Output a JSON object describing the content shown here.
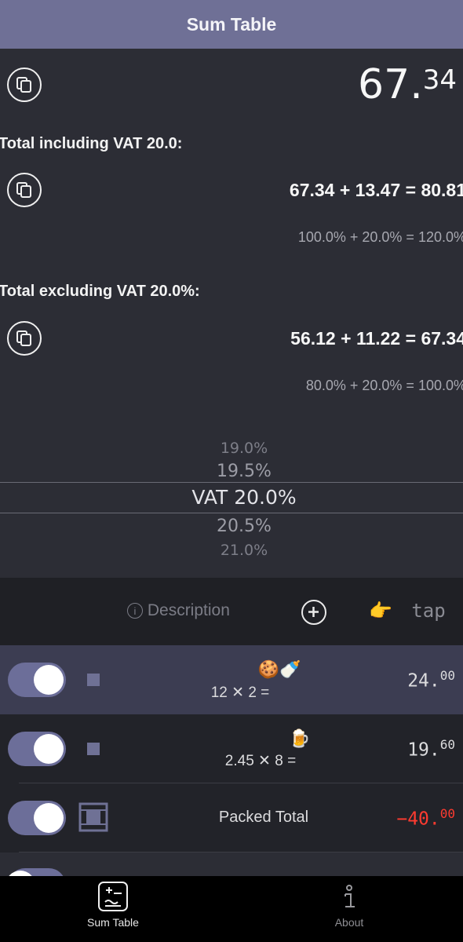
{
  "nav": {
    "title": "Sum Table"
  },
  "total": {
    "integer": "67.",
    "cents": "34"
  },
  "including": {
    "label": "Total including VAT 20.0:",
    "equation": "67.34 + 13.47 = 80.81",
    "percent": "100.0% + 20.0% = 120.0%"
  },
  "excluding": {
    "label": "Total excluding VAT 20.0%:",
    "equation": "56.12 + 11.22 = 67.34",
    "percent": "80.0% + 20.0% = 100.0%"
  },
  "vat_picker": {
    "above": [
      "19.0%",
      "19.5%"
    ],
    "selected": "VAT 20.0%",
    "below": [
      "20.5%",
      "21.0%"
    ]
  },
  "toolbar": {
    "description_label": "Description",
    "tap_label": "tap"
  },
  "rows": [
    {
      "emoji": "🍪🍼",
      "formula": "12 ✕ 2 =",
      "value_int": "24.",
      "value_cents": "00",
      "value_color": "#dcdcde",
      "enabled": true
    },
    {
      "emoji": "🍺",
      "formula": "2.45 ✕ 8 =",
      "value_int": "19.",
      "value_cents": "60",
      "value_color": "#dcdcde",
      "enabled": true
    },
    {
      "label": "Packed Total",
      "value_int": "−40.",
      "value_cents": "00",
      "value_color": "#ff3b30",
      "enabled": true
    }
  ],
  "tabs": [
    {
      "label": "Sum Table",
      "icon": "sum-table-icon",
      "active": true
    },
    {
      "label": "About",
      "icon": "info-icon",
      "active": false
    }
  ],
  "colors": {
    "accent": "#6f7096",
    "background": "#2c2d35",
    "negative": "#ff3b30"
  }
}
